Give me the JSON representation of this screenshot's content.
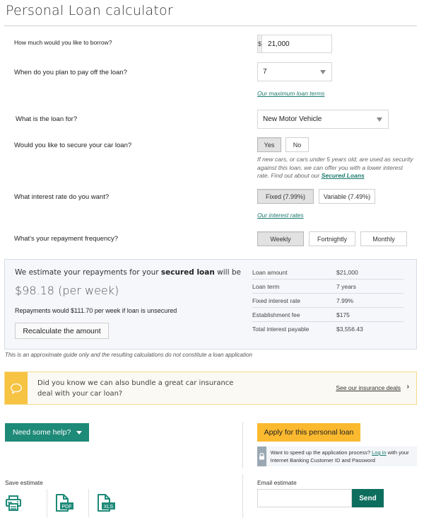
{
  "page": {
    "title": "Personal Loan calculator"
  },
  "questions": {
    "borrow": {
      "label": "How much would you like to borrow?",
      "currency_symbol": "$",
      "value": "21,000"
    },
    "term": {
      "label": "When do you plan to pay off the loan?",
      "value": "7",
      "link": "Our maximum loan terms"
    },
    "purpose": {
      "label": "What is the loan for?",
      "value": "New Motor Vehicle"
    },
    "secure": {
      "label": "Would you like to secure your car loan?",
      "options": [
        {
          "label": "Yes",
          "selected": true
        },
        {
          "label": "No",
          "selected": false
        }
      ],
      "note": "If new cars, or cars under 5 years old, are used as security against this loan, we can offer you with a lower interest rate. Find out about our ",
      "note_link": "Secured Loans"
    },
    "rate": {
      "label": "What interest rate do you want?",
      "options": [
        {
          "label": "Fixed (7.99%)",
          "selected": true
        },
        {
          "label": "Variable (7.49%)",
          "selected": false
        }
      ],
      "link": "Our interest rates"
    },
    "frequency": {
      "label": "What's your repayment frequency?",
      "options": [
        {
          "label": "Weekly",
          "selected": true
        },
        {
          "label": "Fortnightly",
          "selected": false
        },
        {
          "label": "Monthly",
          "selected": false
        }
      ]
    }
  },
  "result": {
    "intro_prefix": "We estimate your repayments for your ",
    "intro_bold": "secured loan",
    "intro_suffix": " will be",
    "amount": "$98.18 (per week)",
    "unsecured_note": "Repayments would $111.70 per week if loan is unsecured",
    "recalc_label": "Recalculate the amount",
    "summary": [
      {
        "label": "Loan amount",
        "value": "$21,000"
      },
      {
        "label": "Loan term",
        "value": "7 years"
      },
      {
        "label": "Fixed interest rate",
        "value": "7.99%"
      },
      {
        "label": "Establishment fee",
        "value": "$175"
      },
      {
        "label": "Total interest payable",
        "value": "$3,556.43"
      }
    ]
  },
  "disclaimer": "This is an approximate guide only and the resulting calculations do not constitute a loan application",
  "promo": {
    "text": "Did you know we can also bundle a great car insurance deal with your car loan?",
    "link": "See our insurance deals",
    "icon": "speech-bubble-icon",
    "accent": "#f6c343"
  },
  "help": {
    "label": "Need some help?"
  },
  "apply": {
    "label": "Apply for this personal loan",
    "color": "#fbb92f",
    "login_prefix": "Want to speed up the application process? ",
    "login_link": "Log in",
    "login_suffix": " with your Internet Banking Customer ID and Password"
  },
  "save": {
    "label": "Save estimate",
    "icons": [
      "printer-icon",
      "pdf-icon",
      "xls-icon"
    ]
  },
  "email": {
    "label": "Email estimate",
    "value": "",
    "send_label": "Send"
  },
  "colors": {
    "brand_green": "#1e8a78",
    "send_green": "#0e6e5e",
    "link_green": "#1b7a6e"
  }
}
